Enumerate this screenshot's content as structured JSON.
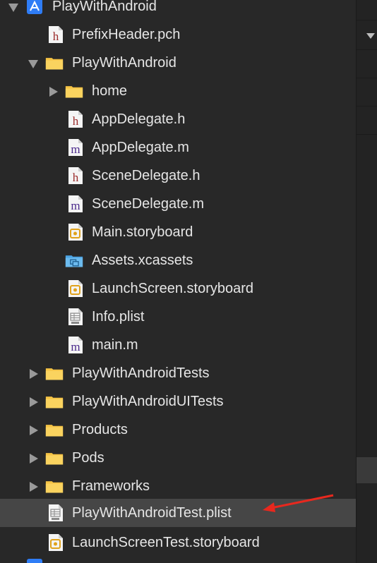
{
  "navigator": {
    "items": [
      {
        "label": "PlayWithAndroid",
        "icon": "xcode-project-icon",
        "disclosure": "down",
        "level": 0
      },
      {
        "label": "PrefixHeader.pch",
        "icon": "h-file-icon",
        "disclosure": "none",
        "level": 1
      },
      {
        "label": "PlayWithAndroid",
        "icon": "folder-icon",
        "disclosure": "down",
        "level": 1
      },
      {
        "label": "home",
        "icon": "folder-icon",
        "disclosure": "right",
        "level": 2
      },
      {
        "label": "AppDelegate.h",
        "icon": "h-file-icon",
        "disclosure": "none",
        "level": 2
      },
      {
        "label": "AppDelegate.m",
        "icon": "m-file-icon",
        "disclosure": "none",
        "level": 2
      },
      {
        "label": "SceneDelegate.h",
        "icon": "h-file-icon",
        "disclosure": "none",
        "level": 2
      },
      {
        "label": "SceneDelegate.m",
        "icon": "m-file-icon",
        "disclosure": "none",
        "level": 2
      },
      {
        "label": "Main.storyboard",
        "icon": "storyboard-icon",
        "disclosure": "none",
        "level": 2
      },
      {
        "label": "Assets.xcassets",
        "icon": "assets-folder-icon",
        "disclosure": "none",
        "level": 2
      },
      {
        "label": "LaunchScreen.storyboard",
        "icon": "storyboard-icon",
        "disclosure": "none",
        "level": 2
      },
      {
        "label": "Info.plist",
        "icon": "plist-icon",
        "disclosure": "none",
        "level": 2
      },
      {
        "label": "main.m",
        "icon": "m-file-icon",
        "disclosure": "none",
        "level": 2
      },
      {
        "label": "PlayWithAndroidTests",
        "icon": "folder-icon",
        "disclosure": "right",
        "level": 1
      },
      {
        "label": "PlayWithAndroidUITests",
        "icon": "folder-icon",
        "disclosure": "right",
        "level": 1
      },
      {
        "label": "Products",
        "icon": "folder-icon",
        "disclosure": "right",
        "level": 1
      },
      {
        "label": "Pods",
        "icon": "folder-icon",
        "disclosure": "right",
        "level": 1
      },
      {
        "label": "Frameworks",
        "icon": "folder-icon",
        "disclosure": "right",
        "level": 1
      },
      {
        "label": "PlayWithAndroidTest.plist",
        "icon": "plist-icon",
        "disclosure": "none",
        "level": 1,
        "selected": true
      },
      {
        "label": "LaunchScreenTest.storyboard",
        "icon": "storyboard-icon",
        "disclosure": "none",
        "level": 1
      }
    ]
  },
  "colors": {
    "background": "#282828",
    "selected_row": "#464646",
    "text": "#e6e6e6",
    "folder": "#f5c344",
    "h_letter": "#9a2a2a",
    "m_letter": "#4b2a8c",
    "annotation_arrow": "#e8281e"
  }
}
